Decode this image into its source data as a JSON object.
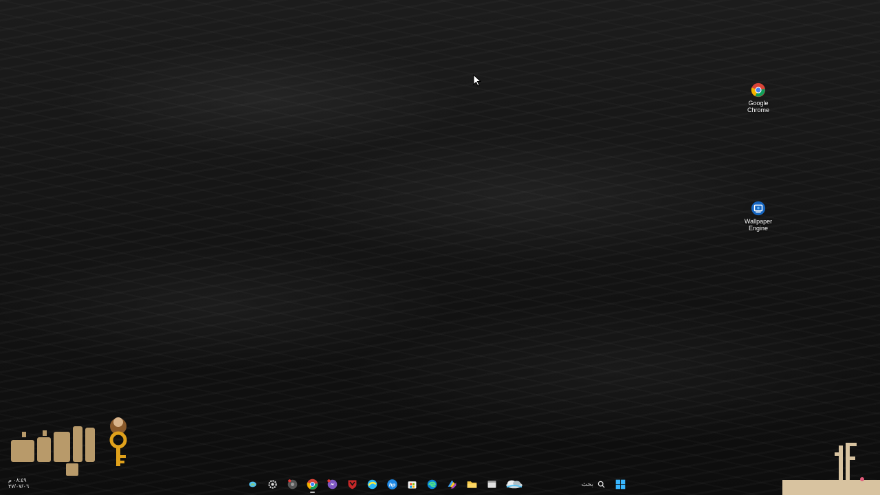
{
  "desktop": {
    "icons": [
      {
        "label_line1": "Google",
        "label_line2": "Chrome"
      },
      {
        "label_line1": "Wallpaper",
        "label_line2": "Engine"
      }
    ]
  },
  "watermark": {
    "line1": "٠٨:٤٩ م",
    "line2": "٢٧/٠٧/٠٦"
  },
  "taskbar": {
    "search_placeholder": "بحث",
    "items": [
      "copilot-icon",
      "settings-icon",
      "media-icon",
      "chrome-icon",
      "messenger-icon",
      "antivirus-icon",
      "browser-icon",
      "hp-icon",
      "store-icon",
      "edge-icon",
      "app-icon",
      "folder-icon",
      "window-icon",
      "weather-icon",
      "search-icon",
      "start-icon"
    ]
  },
  "colors": {
    "chrome_red": "#db4437",
    "chrome_green": "#0f9d58",
    "chrome_yellow": "#f4b400",
    "chrome_blue": "#4285f4",
    "start_blue": "#38b6ff",
    "folder_yellow": "#f7c948",
    "logo_tan": "#b89a6a"
  }
}
